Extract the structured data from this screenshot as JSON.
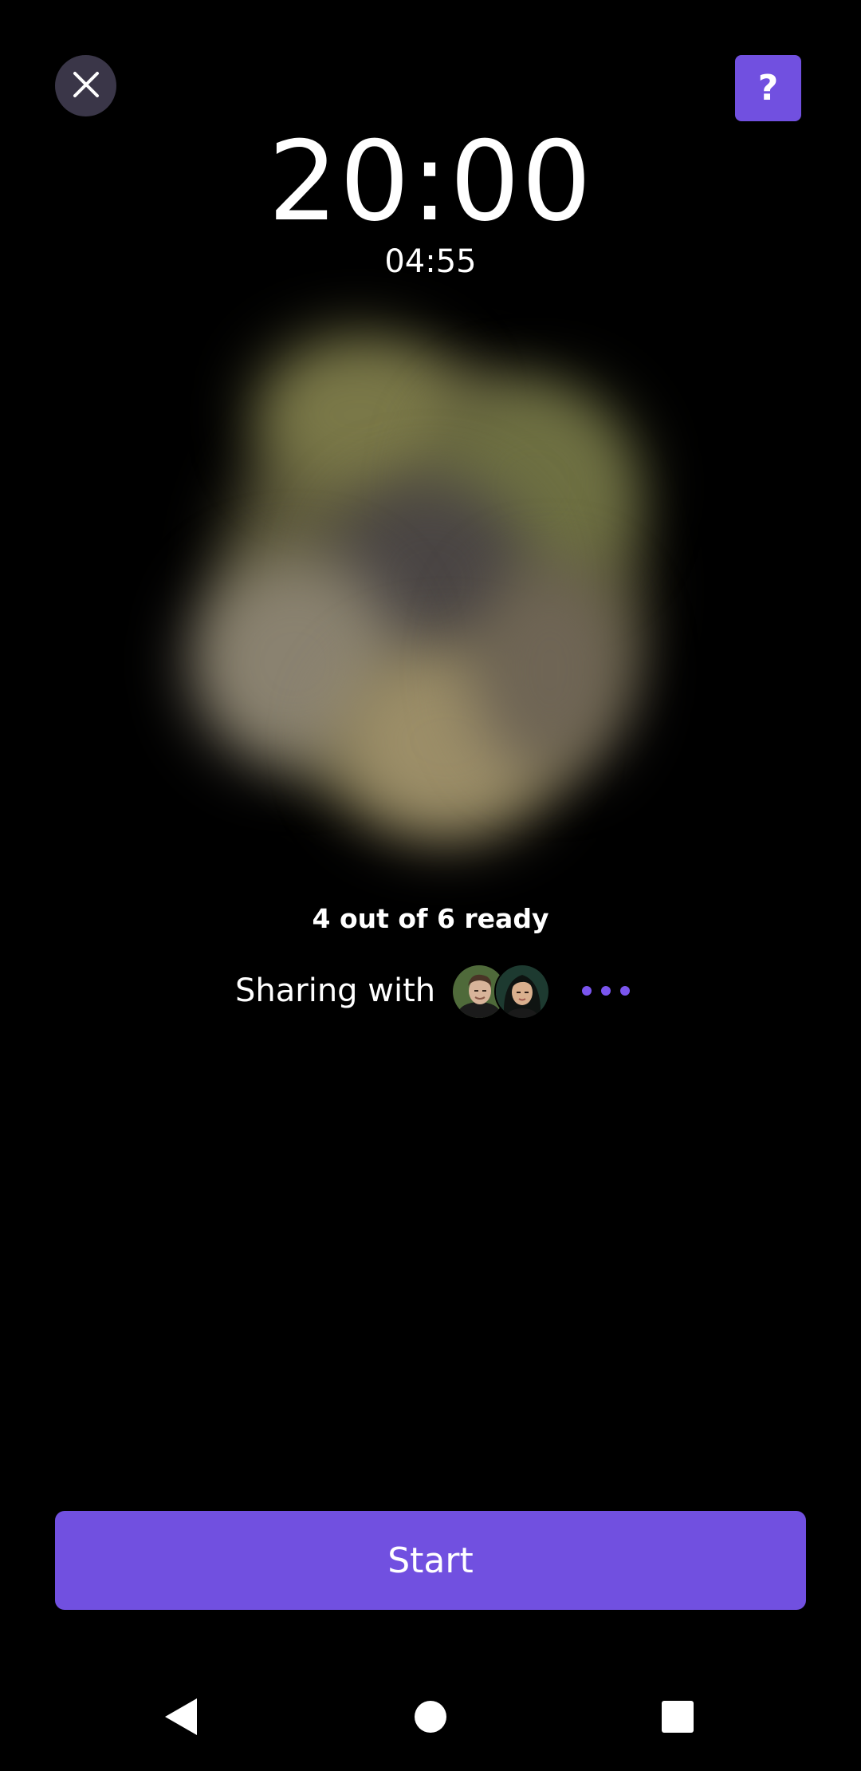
{
  "header": {
    "close_icon": "close-icon",
    "help_label": "?",
    "accent_color": "#7150e0"
  },
  "timer": {
    "main": "20:00",
    "sub": "04:55"
  },
  "status": {
    "ready_text": "4 out of 6 ready"
  },
  "sharing": {
    "label": "Sharing with",
    "avatars": [
      "avatar-man",
      "avatar-woman"
    ],
    "more_icon": "more-dots-icon"
  },
  "actions": {
    "start_label": "Start"
  },
  "nav": {
    "back_icon": "back-triangle-icon",
    "home_icon": "home-circle-icon",
    "recents_icon": "recents-square-icon"
  }
}
